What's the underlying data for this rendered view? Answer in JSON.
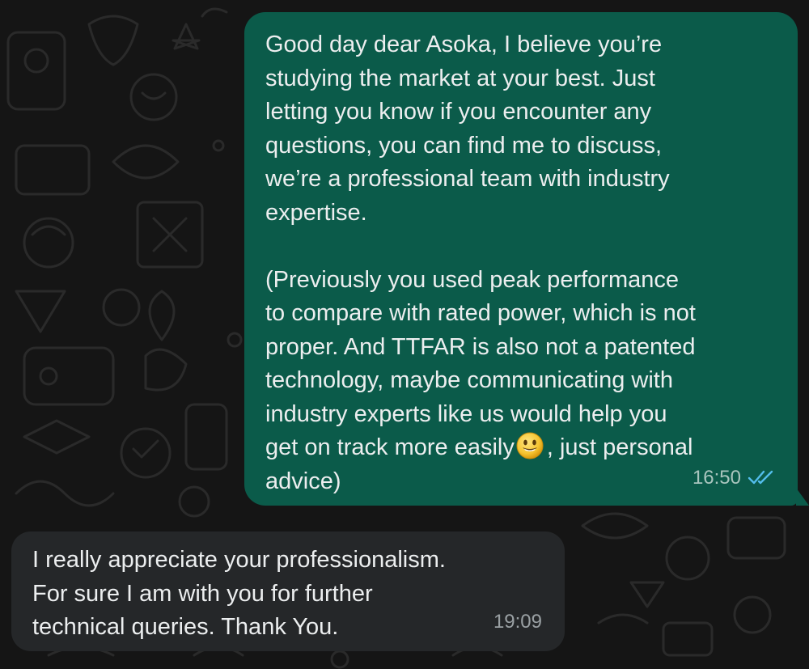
{
  "messages": {
    "outgoing": {
      "para1": "Good day dear Asoka, I believe you’re\nstudying the market at your best. Just\nletting you know if you encounter any\nquestions, you can find me to discuss,\nwe’re a professional team with industry\nexpertise.",
      "para2_before_emoji": "(Previously you used peak performance\nto compare with rated power, which is not\nproper. And TTFAR is also not a patented\ntechnology, maybe communicating with\nindustry experts like us would help you\nget on track more easily",
      "para2_after_emoji": ", just personal\nadvice)",
      "time": "16:50",
      "status": "read",
      "emoji": "smiling-face-emoji"
    },
    "incoming": {
      "text": "I really appreciate your professionalism.\nFor sure I am with you for further\ntechnical queries. Thank You.",
      "time": "19:09"
    }
  },
  "colors": {
    "background": "#151515",
    "outgoing_bubble": "#0B5B4A",
    "incoming_bubble": "#252729",
    "text": "#ECEEEF",
    "read_ticks": "#53BDEB"
  }
}
